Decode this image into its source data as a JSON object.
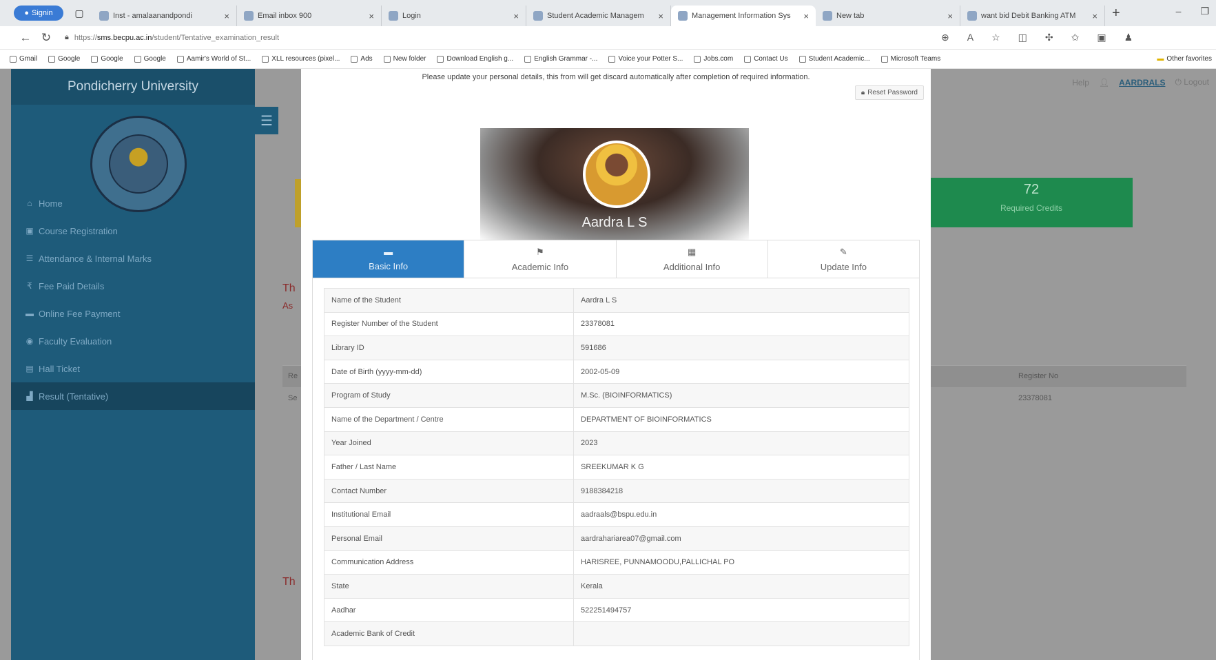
{
  "browser": {
    "profile_label": "Signin",
    "tabs": [
      {
        "title": "Inst - amalaanandpondi",
        "active": false
      },
      {
        "title": "Email inbox 900",
        "active": false
      },
      {
        "title": "Login",
        "active": false
      },
      {
        "title": "Student Academic Managem",
        "active": false
      },
      {
        "title": "Management Information Sys",
        "active": true
      },
      {
        "title": "New tab",
        "active": false
      },
      {
        "title": "want bid Debit Banking ATM",
        "active": false
      }
    ],
    "url_prefix": "https://",
    "url_host": "sms.becpu.ac.in",
    "url_path": "/student/Tentative_examination_result",
    "bookmarks": [
      "Gmail",
      "Google",
      "Google",
      "Google",
      "Aamir's World of St...",
      "XLL resources (pixel...",
      "Ads",
      "New folder",
      "Download English g...",
      "English Grammar -...",
      "Voice your Potter S...",
      "Jobs.com",
      "Contact Us",
      "Student Academic...",
      "Microsoft Teams"
    ],
    "other_favorites": "Other favorites"
  },
  "sidebar": {
    "title": "Pondicherry University",
    "items": [
      {
        "label": "Home",
        "icon": "home-icon",
        "glyph": "⌂"
      },
      {
        "label": "Course Registration",
        "icon": "register-icon",
        "glyph": "▣"
      },
      {
        "label": "Attendance & Internal Marks",
        "icon": "list-icon",
        "glyph": "☰"
      },
      {
        "label": "Fee Paid Details",
        "icon": "rupee-icon",
        "glyph": "₹"
      },
      {
        "label": "Online Fee Payment",
        "icon": "card-icon",
        "glyph": "▬"
      },
      {
        "label": "Faculty Evaluation",
        "icon": "eye-icon",
        "glyph": "◉"
      },
      {
        "label": "Hall Ticket",
        "icon": "ticket-icon",
        "glyph": "▤"
      },
      {
        "label": "Result (Tentative)",
        "icon": "chart-icon",
        "glyph": "▟"
      }
    ]
  },
  "header": {
    "help": "Help",
    "username": "AARDRALS",
    "logout": "Logout"
  },
  "background": {
    "credit_value": "72",
    "credit_label": "Required Credits",
    "red_text_1": "Th",
    "red_text_2": "As",
    "red_text_3": "Th",
    "table_col_register": "Register No",
    "table_register_value": "23378081",
    "table_left_head": "Re",
    "table_left_cell": "Se"
  },
  "modal": {
    "notice": "Please update your personal details, this from will get discard automatically after completion of required information.",
    "reset_label": "Reset Password",
    "profile_name": "Aardra L S",
    "tabs": [
      {
        "label": "Basic Info",
        "icon": "card-icon",
        "glyph": "▬",
        "active": true
      },
      {
        "label": "Academic Info",
        "icon": "flag-icon",
        "glyph": "⚑",
        "active": false
      },
      {
        "label": "Additional Info",
        "icon": "grid-icon",
        "glyph": "▦",
        "active": false
      },
      {
        "label": "Update Info",
        "icon": "pencil-icon",
        "glyph": "✎",
        "active": false
      }
    ],
    "fields": [
      {
        "label": "Name of the Student",
        "value": "Aardra L S"
      },
      {
        "label": "Register Number of the Student",
        "value": "23378081"
      },
      {
        "label": "Library ID",
        "value": "591686"
      },
      {
        "label": "Date of Birth (yyyy-mm-dd)",
        "value": "2002-05-09"
      },
      {
        "label": "Program of Study",
        "value": "M.Sc. (BIOINFORMATICS)"
      },
      {
        "label": "Name of the Department / Centre",
        "value": "DEPARTMENT OF BIOINFORMATICS"
      },
      {
        "label": "Year Joined",
        "value": "2023"
      },
      {
        "label": "Father / Last Name",
        "value": "SREEKUMAR K G"
      },
      {
        "label": "Contact Number",
        "value": "9188384218"
      },
      {
        "label": "Institutional Email",
        "value": "aadraals@bspu.edu.in"
      },
      {
        "label": "Personal Email",
        "value": "aardrahariarea07@gmail.com"
      },
      {
        "label": "Communication Address",
        "value": "HARISREE, PUNNAMOODU,PALLICHAL PO"
      },
      {
        "label": "State",
        "value": "Kerala"
      },
      {
        "label": "Aadhar",
        "value": "522251494757"
      },
      {
        "label": "Academic Bank of Credit",
        "value": ""
      }
    ]
  }
}
